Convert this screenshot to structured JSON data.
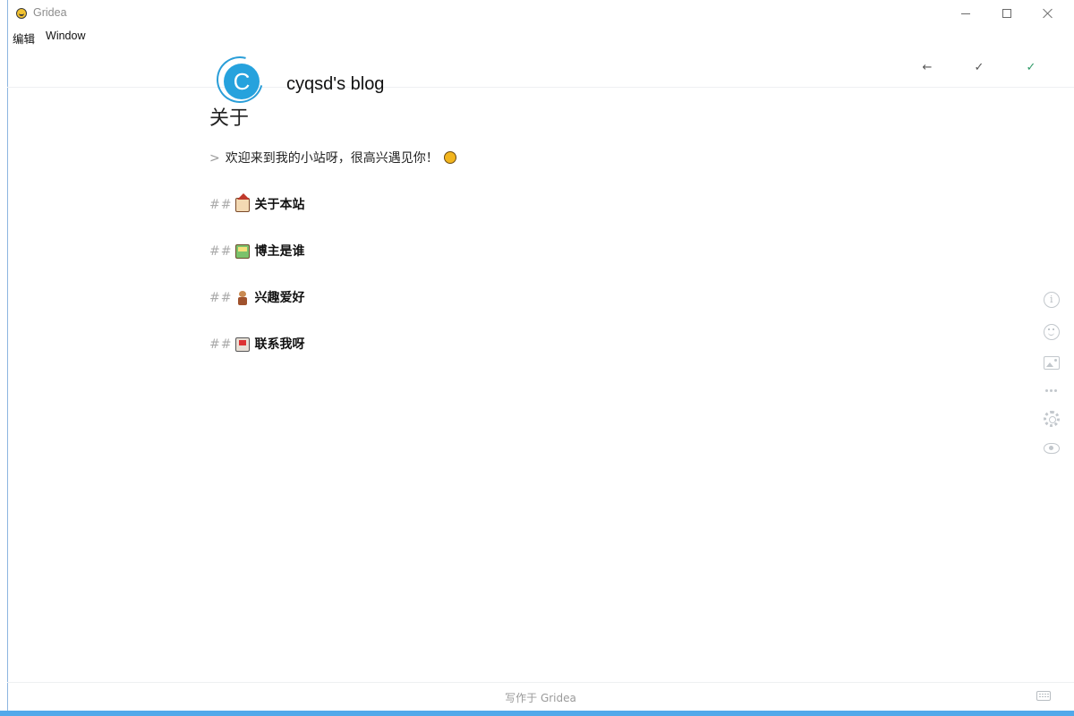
{
  "window": {
    "title": "Gridea",
    "icon": "gridea-app-icon"
  },
  "menubar": {
    "items": [
      "编辑",
      "Window"
    ]
  },
  "header": {
    "blog_name": "cyqsd's blog",
    "logo_letter": "C",
    "back_icon": "←",
    "save_draft_icon": "✓",
    "publish_icon": "✓",
    "publish_color": "#2f9a68"
  },
  "document": {
    "title": "关于",
    "quote_marker": ">",
    "quote_text": "欢迎来到我的小站呀，很高兴遇见你！",
    "headings": [
      {
        "hash": "##",
        "text": "关于本站",
        "emoji": "house-emoji"
      },
      {
        "hash": "##",
        "text": "博主是谁",
        "emoji": "framed-picture-emoji"
      },
      {
        "hash": "##",
        "text": "兴趣爱好",
        "emoji": "person-emoji"
      },
      {
        "hash": "##",
        "text": "联系我呀",
        "emoji": "mailbox-emoji"
      }
    ]
  },
  "toolbar": {
    "icons": [
      "info-icon",
      "emoji-icon",
      "image-icon",
      "more-icon",
      "settings-icon",
      "preview-icon"
    ]
  },
  "footer": {
    "text": "写作于 Gridea",
    "keyboard_icon": "keyboard-icon"
  }
}
